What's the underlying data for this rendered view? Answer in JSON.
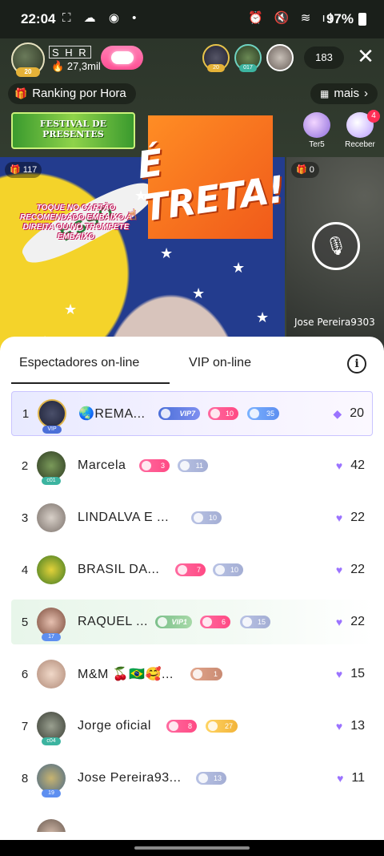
{
  "status_bar": {
    "time": "22:04",
    "battery": "97%"
  },
  "header": {
    "host_name": "S H R",
    "host_followers": "27,3mil",
    "host_level": "20",
    "viewers": [
      {
        "badge": "20",
        "badge_color": "#e5b238"
      },
      {
        "badge": "017",
        "badge_color": "#3cb4a0"
      },
      {
        "badge": "",
        "badge_color": ""
      }
    ],
    "viewer_count": "183"
  },
  "toolbar": {
    "ranking_label": "Ranking por Hora",
    "more_label": "mais",
    "festival_label": "FESTIVAL DE PRESENTES",
    "treta_label": "É TRETA!",
    "side_buttons": [
      {
        "label": "Ter5"
      },
      {
        "label": "Receber",
        "badge": "4"
      }
    ]
  },
  "stream": {
    "host_gift_count": "117",
    "guest_gift_count": "0",
    "guest_name": "Jose Pereira9303",
    "promo_text": "TOQUE NO CARTÃO RECOMENDADO EMBAIXO À DIREITA OU NO TROMPETE EMBAIXO",
    "flag_text": "ESSO"
  },
  "sheet": {
    "tabs": [
      {
        "label": "Espectadores on-line"
      },
      {
        "label": "VIP on-line"
      }
    ],
    "info_glyph": "i",
    "rows": [
      {
        "rank": "1",
        "name": "🌏REMA...",
        "vip": "VIP7",
        "heart": "10",
        "level": "35",
        "score": "20",
        "avatar_badge": "VIP"
      },
      {
        "rank": "2",
        "name": "Marcela",
        "heart": "3",
        "level": "11",
        "score": "42",
        "avatar_badge": "c01"
      },
      {
        "rank": "3",
        "name": "LINDALVA E ...",
        "level": "10",
        "score": "22",
        "avatar_badge": ""
      },
      {
        "rank": "4",
        "name": "BRASIL DA...",
        "heart": "7",
        "level": "10",
        "score": "22",
        "avatar_badge": ""
      },
      {
        "rank": "5",
        "name": "RAQUEL ...",
        "vip": "VIP1",
        "heart": "6",
        "level": "15",
        "score": "22",
        "avatar_badge": "17"
      },
      {
        "rank": "6",
        "name": "M&M 🍒🇧🇷🥰...",
        "level": "1",
        "score": "15",
        "avatar_badge": ""
      },
      {
        "rank": "7",
        "name": "Jorge oficial",
        "heart": "8",
        "level": "27",
        "score": "13",
        "avatar_badge": "c04"
      },
      {
        "rank": "8",
        "name": "Jose Pereira93...",
        "level": "13",
        "score": "11",
        "avatar_badge": "19"
      }
    ]
  },
  "colors": {
    "accent_pink": "#ff4a84",
    "vip_blue": "#4b6fd8",
    "gem_purple": "#9b73ff"
  }
}
